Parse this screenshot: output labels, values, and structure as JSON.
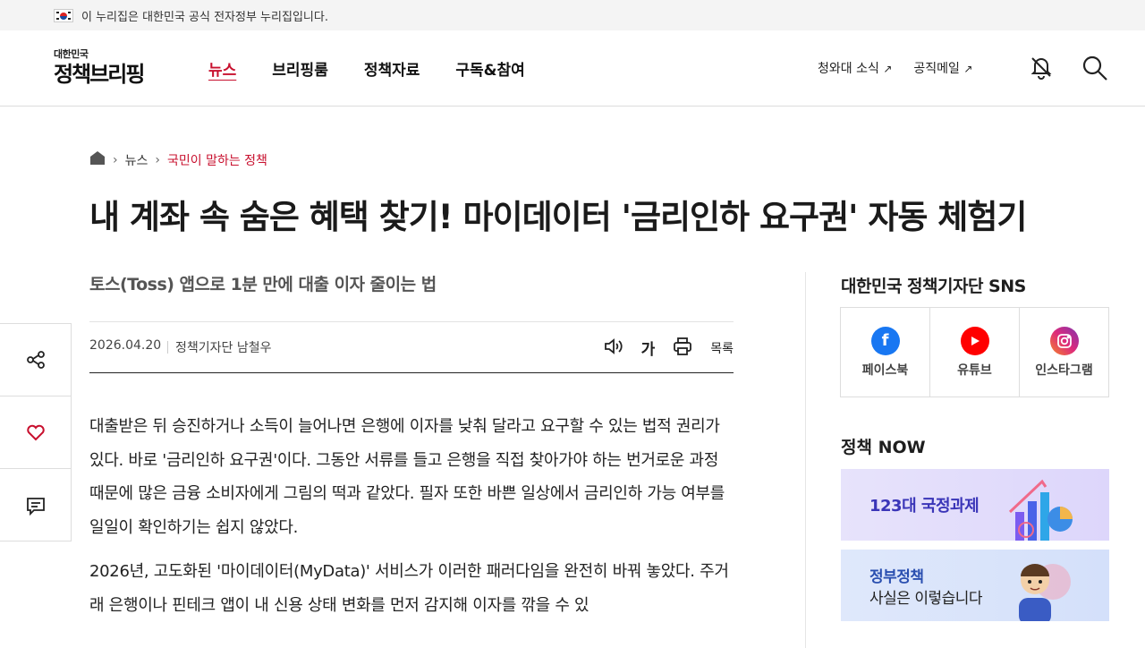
{
  "gov_bar": {
    "notice": "이 누리집은 대한민국 공식 전자정부 누리집입니다."
  },
  "logo": {
    "small": "대한민국",
    "big": "정책브리핑"
  },
  "gnb": [
    {
      "label": "뉴스",
      "active": true
    },
    {
      "label": "브리핑룸",
      "active": false
    },
    {
      "label": "정책자료",
      "active": false
    },
    {
      "label": "구독&참여",
      "active": false
    }
  ],
  "util": [
    {
      "label": "청와대 소식",
      "arrow": "↗"
    },
    {
      "label": "공직메일",
      "arrow": "↗"
    }
  ],
  "breadcrumb": {
    "level1": "뉴스",
    "current": "국민이 말하는 정책"
  },
  "article": {
    "title": "내 계좌 속 숨은 혜택 찾기! 마이데이터 '금리인하 요구권' 자동 체험기",
    "subtitle": "토스(Toss) 앱으로 1분 만에 대출 이자 줄이는 법",
    "date": "2026.04.20",
    "author": "정책기자단 남철우",
    "font_label": "가",
    "list_label": "목록",
    "paragraphs": [
      "대출받은 뒤 승진하거나 소득이 늘어나면 은행에 이자를 낮춰 달라고 요구할 수 있는 법적 권리가 있다. 바로 '금리인하 요구권'이다. 그동안 서류를 들고 은행을 직접 찾아가야 하는 번거로운 과정 때문에 많은 금융 소비자에게 그림의 떡과 같았다. 필자 또한 바쁜 일상에서 금리인하 가능 여부를 일일이 확인하기는 쉽지 않았다.",
      "2026년, 고도화된 '마이데이터(MyData)' 서비스가 이러한 패러다임을 완전히 바꿔 놓았다. 주거래 은행이나 핀테크 앱이 내 신용 상태 변화를 먼저 감지해 이자를 깎을 수 있"
    ]
  },
  "sidebar": {
    "sns_title": "대한민국 정책기자단 SNS",
    "sns": [
      {
        "label": "페이스북",
        "icon": "facebook-icon",
        "color": "#1877f2"
      },
      {
        "label": "유튜브",
        "icon": "youtube-icon",
        "color": "#ff0000"
      },
      {
        "label": "인스타그램",
        "icon": "instagram-icon",
        "color": "#d62976"
      }
    ],
    "now_title": "정책 NOW",
    "banners": [
      {
        "line1": "123대 국정과제"
      },
      {
        "line1": "정부정책",
        "line2": "사실은 이렇습니다"
      }
    ]
  },
  "colors": {
    "accent": "#c8102e",
    "text": "#1e1e1e"
  }
}
